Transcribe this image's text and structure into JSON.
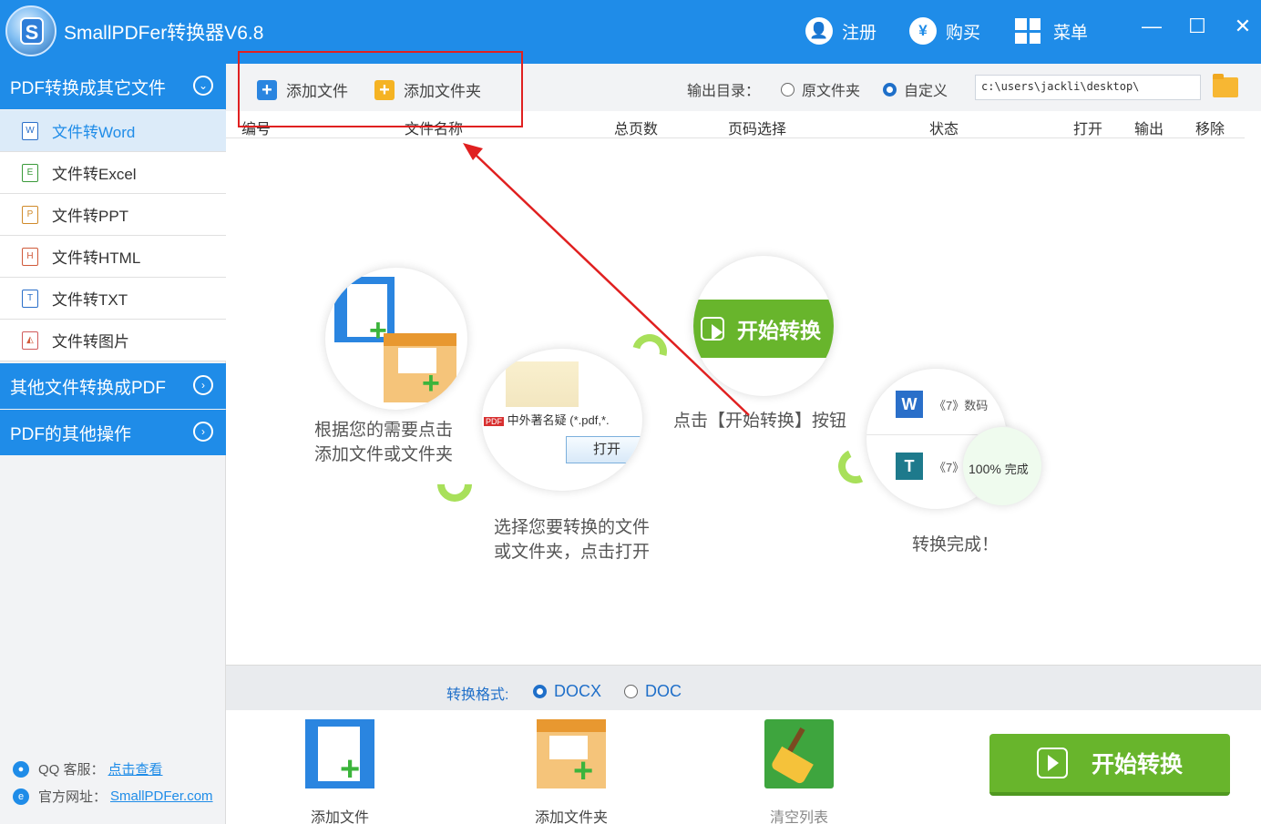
{
  "app": {
    "title": "SmallPDFer转换器V6.8",
    "logo_letter": "S",
    "register_label": "注册",
    "buy_label": "购买",
    "menu_label": "菜单",
    "minimize": "—",
    "maximize": "☐",
    "close": "✕"
  },
  "sidebar": {
    "categories": [
      {
        "label": "PDF转换成其它文件",
        "chevron": "⌄"
      },
      {
        "label": "其他文件转换成PDF",
        "chevron": "›"
      },
      {
        "label": "PDF的其他操作",
        "chevron": "›"
      }
    ],
    "items": [
      {
        "label": "文件转Word",
        "icon_letter": "W"
      },
      {
        "label": "文件转Excel",
        "icon_letter": "E"
      },
      {
        "label": "文件转PPT",
        "icon_letter": "P"
      },
      {
        "label": "文件转HTML",
        "icon_letter": "H"
      },
      {
        "label": "文件转TXT",
        "icon_letter": "T"
      },
      {
        "label": "文件转图片",
        "icon_letter": ""
      }
    ],
    "support": {
      "qq_label": "QQ 客服：",
      "qq_link": "点击查看",
      "site_label": "官方网址：",
      "site_link": "SmallPDFer.com"
    }
  },
  "toolbar": {
    "add_file": "添加文件",
    "add_folder": "添加文件夹",
    "output_dir_label": "输出目录：",
    "option_source": "原文件夹",
    "option_custom": "自定义",
    "path_value": "c:\\users\\jackli\\desktop\\"
  },
  "table_header": {
    "index": "编号",
    "filename": "文件名称",
    "pages": "总页数",
    "page_select": "页码选择",
    "status": "状态",
    "open": "打开",
    "output": "输出",
    "remove": "移除"
  },
  "guide": {
    "step1": [
      "根据您的需要点击",
      "添加文件或文件夹"
    ],
    "step2": [
      "选择您要转换的文件",
      "或文件夹，点击打开"
    ],
    "step3": "点击【开始转换】按钮",
    "step4": "转换完成！",
    "step2_file_label": "中外著名疑",
    "step2_filter": "(*.pdf,*.",
    "step2_open": "打开",
    "step2_pdf_badge": "PDF",
    "step3_button": "开始转换",
    "step4_row1": "《7》数码",
    "step4_row2": "《7》",
    "step4_progress": "100%",
    "step4_done": "完成"
  },
  "format_bar": {
    "label": "转换格式:",
    "docx": "DOCX",
    "doc": "DOC",
    "selected": "DOCX"
  },
  "actions": {
    "add_file": "添加文件",
    "add_folder": "添加文件夹",
    "clear_list": "清空列表",
    "start": "开始转换"
  },
  "colors": {
    "primary_blue": "#1f8ce8",
    "green": "#68b52c",
    "annotation_red": "#e02020"
  }
}
